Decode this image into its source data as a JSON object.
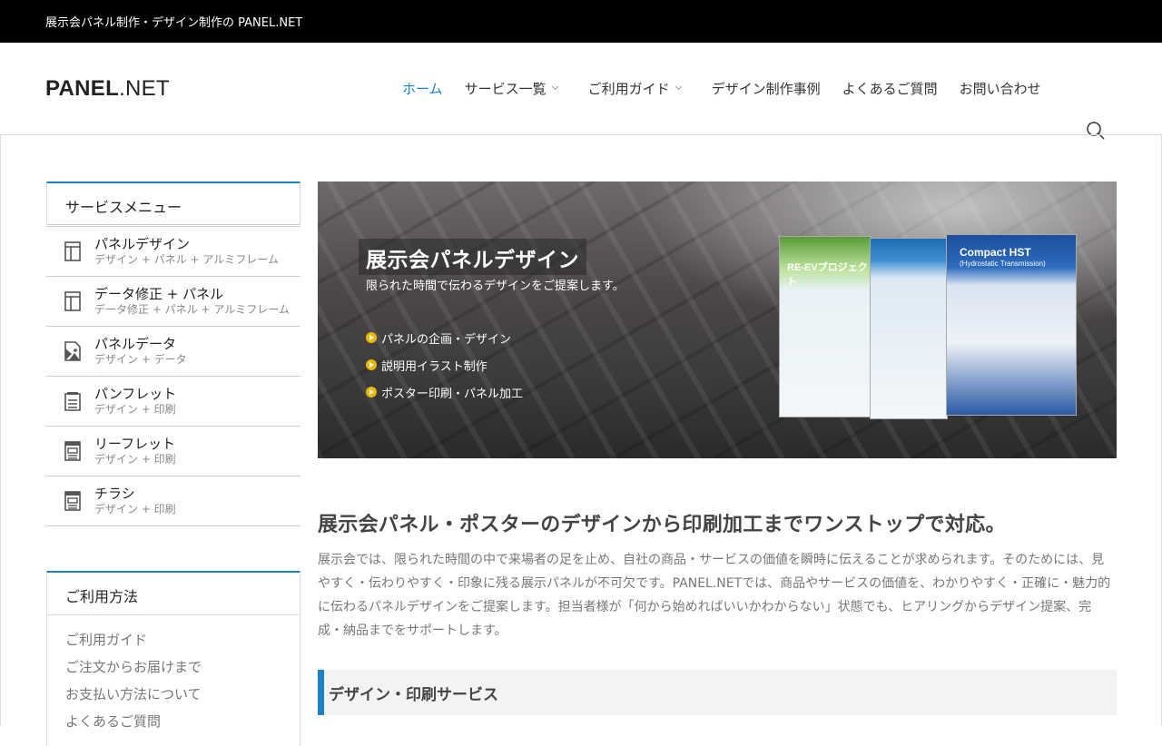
{
  "topbar": {
    "tagline": "展示会パネル制作・デザイン制作の PANEL.NET"
  },
  "header": {
    "logo_bold": "PANEL",
    "logo_rest": ".NET",
    "nav": [
      {
        "label": "ホーム",
        "active": true
      },
      {
        "label": "サービス一覧",
        "submenu": true
      },
      {
        "label": "ご利用ガイド",
        "submenu": true
      },
      {
        "label": "デザイン制作事例"
      },
      {
        "label": "よくあるご質問"
      },
      {
        "label": "お問い合わせ"
      }
    ],
    "search_icon": "search-icon"
  },
  "sidebar": {
    "service_menu": {
      "title": "サービスメニュー",
      "items": [
        {
          "label": "パネルデザイン",
          "sub": "デザイン + パネル + アルミフレーム",
          "icon": "layout-icon"
        },
        {
          "label": "データ修正 + パネル",
          "sub": "データ修正 + パネル + アルミフレーム",
          "icon": "layout-icon"
        },
        {
          "label": "パネルデータ",
          "sub": "デザイン + データ",
          "icon": "file-image-icon"
        },
        {
          "label": "パンフレット",
          "sub": "デザイン + 印刷",
          "icon": "document-icon"
        },
        {
          "label": "リーフレット",
          "sub": "デザイン + 印刷",
          "icon": "newspaper-icon"
        },
        {
          "label": "チラシ",
          "sub": "デザイン + 印刷",
          "icon": "newspaper-icon"
        }
      ]
    },
    "usage": {
      "title": "ご利用方法",
      "links": [
        "ご利用ガイド",
        "ご注文からお届けまで",
        "お支払い方法について",
        "よくあるご質問"
      ]
    }
  },
  "hero": {
    "title": "展示会パネルデザイン",
    "subtitle": "限られた時間で伝わるデザインをご提案します。",
    "bullets": [
      "パネルの企画・デザイン",
      "説明用イラスト制作",
      "ポスター印刷・パネル加工"
    ],
    "poster_labels": [
      "RE-EVプロジェクト",
      "Compact HST",
      "(Hydrostatic Transmission)"
    ]
  },
  "main": {
    "heading": "展示会パネル・ポスターのデザインから印刷加工までワンストップで対応。",
    "paragraph": "展示会では、限られた時間の中で来場者の足を止め、自社の商品・サービスの価値を瞬時に伝えることが求められます。そのためには、見やすく・伝わりやすく・印象に残る展示パネルが不可欠です。PANEL.NETでは、商品やサービスの価値を、わかりやすく・正確に・魅力的に伝わるパネルデザインをご提案します。担当者様が「何から始めればいいかわからない」状態でも、ヒアリングからデザイン提案、完成・納品までをサポートします。",
    "section_title": "デザイン・印刷サービス"
  },
  "colors": {
    "accent": "#1d82c4",
    "topbar_bg": "#000000",
    "bullet": "#e9b800"
  }
}
